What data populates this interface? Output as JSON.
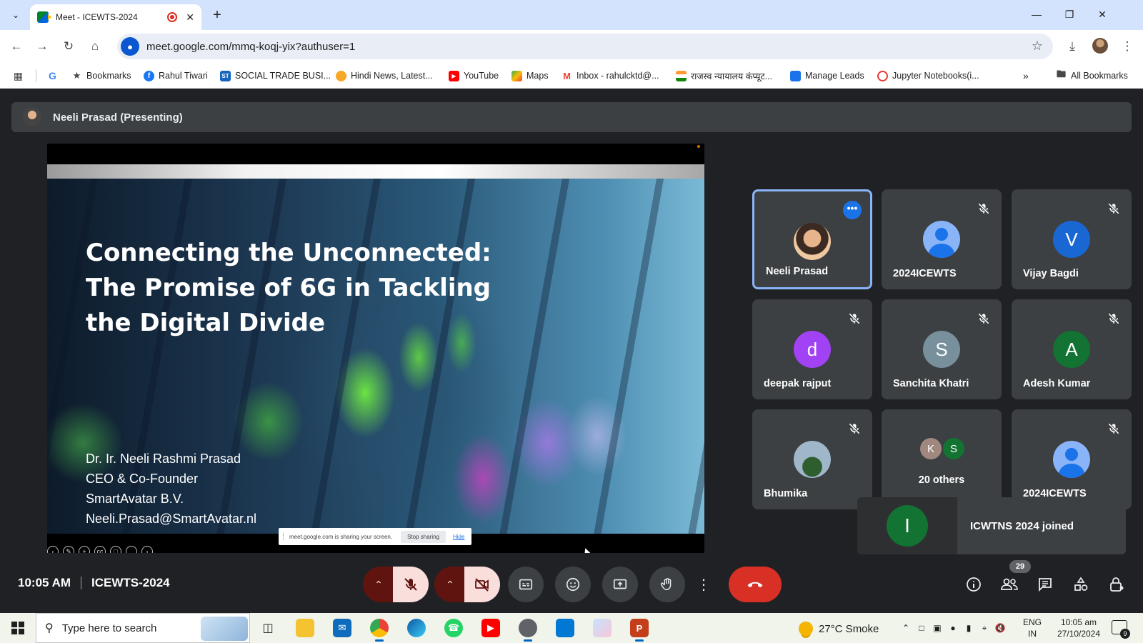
{
  "browser": {
    "tab_title": "Meet - ICEWTS-2024",
    "url": "meet.google.com/mmq-koqj-yix?authuser=1",
    "bookmarks": [
      {
        "label": "Bookmarks"
      },
      {
        "label": "Rahul Tiwari"
      },
      {
        "label": "SOCIAL TRADE BUSI..."
      },
      {
        "label": "Hindi News, Latest..."
      },
      {
        "label": "YouTube"
      },
      {
        "label": "Maps"
      },
      {
        "label": "Inbox - rahulcktd@..."
      },
      {
        "label": "राजस्व न्यायालय कंप्यूट..."
      },
      {
        "label": "Manage Leads"
      },
      {
        "label": "Jupyter Notebooks(i..."
      }
    ],
    "all_bookmarks": "All Bookmarks"
  },
  "meet": {
    "presenter_label": "Neeli Prasad (Presenting)",
    "slide": {
      "title_lines": [
        "Connecting the Unconnected:",
        "The Promise of 6G in Tackling",
        "the Digital Divide"
      ],
      "author_lines": [
        "Dr. Ir. Neeli Rashmi Prasad",
        "CEO & Co-Founder",
        "SmartAvatar B.V.",
        "Neeli.Prasad@SmartAvatar.nl"
      ],
      "share_notice": "meet.google.com is sharing your screen.",
      "stop_sharing": "Stop sharing",
      "hide": "Hide"
    },
    "participants": [
      {
        "name": "Neeli Prasad",
        "initial": "",
        "color": "",
        "kind": "photo"
      },
      {
        "name": "2024ICEWTS",
        "initial": "",
        "color": "#8ab4f8",
        "kind": "generic"
      },
      {
        "name": "Vijay Bagdi",
        "initial": "V",
        "color": "#1967d2",
        "kind": "letter"
      },
      {
        "name": "deepak rajput",
        "initial": "d",
        "color": "#a142f4",
        "kind": "letter"
      },
      {
        "name": "Sanchita Khatri",
        "initial": "S",
        "color": "#78909c",
        "kind": "letter"
      },
      {
        "name": "Adesh Kumar",
        "initial": "A",
        "color": "#137333",
        "kind": "letter"
      },
      {
        "name": "Bhumika",
        "initial": "",
        "color": "",
        "kind": "photo2"
      },
      {
        "name": "20 others",
        "initial": "",
        "color": "",
        "kind": "others"
      },
      {
        "name": "2024ICEWTS",
        "initial": "",
        "color": "#8ab4f8",
        "kind": "generic"
      }
    ],
    "others_initials": [
      "K",
      "S"
    ],
    "toast": {
      "initial": "I",
      "text": "ICWTNS 2024 joined"
    },
    "time": "10:05 AM",
    "meeting_name": "ICEWTS-2024",
    "people_count": "29"
  },
  "taskbar": {
    "search_placeholder": "Type here to search",
    "weather": "27°C  Smoke",
    "lang_top": "ENG",
    "lang_bottom": "IN",
    "time": "10:05 am",
    "date": "27/10/2024",
    "notifications": "9"
  }
}
